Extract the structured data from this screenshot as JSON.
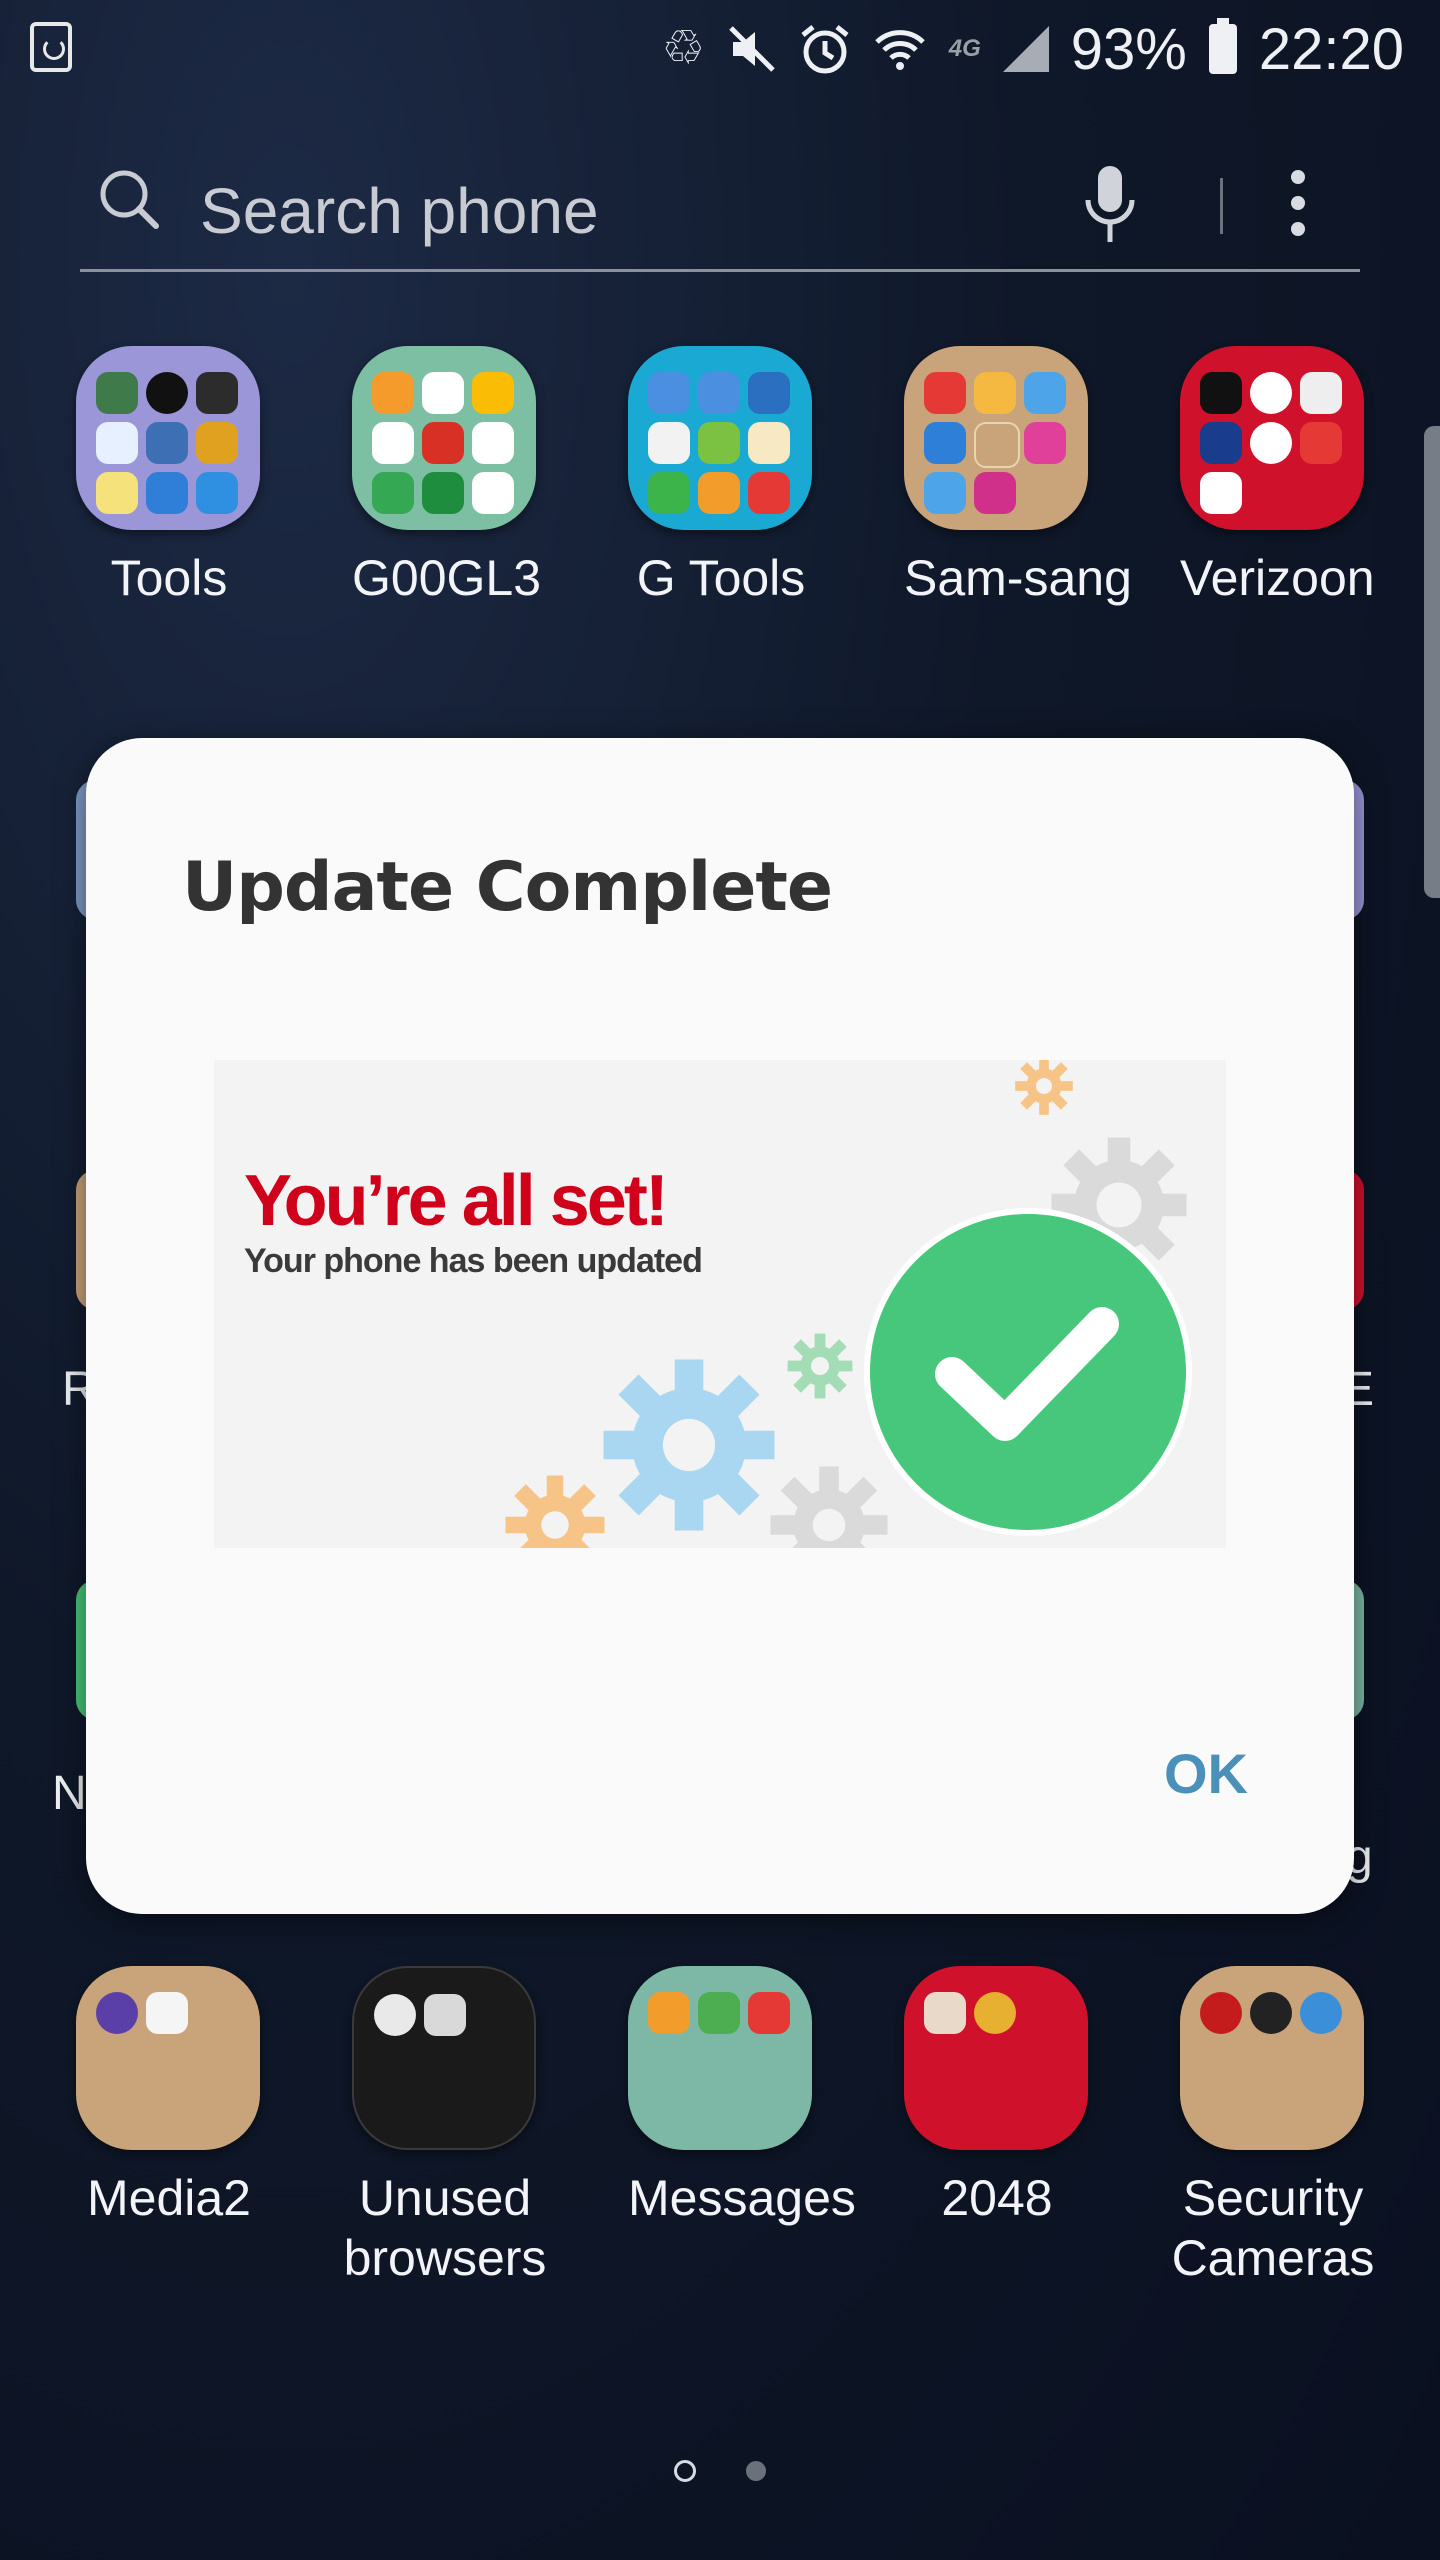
{
  "status_bar": {
    "battery": "93%",
    "time": "22:20",
    "network": "4G",
    "icons": [
      "recycle-icon",
      "mute-icon",
      "alarm-icon",
      "wifi-icon",
      "lte-icon",
      "signal-icon",
      "battery-icon"
    ]
  },
  "search": {
    "placeholder": "Search phone"
  },
  "folders_top": [
    {
      "label": "Tools",
      "color": "#9b96d8"
    },
    {
      "label": "G00GL3",
      "color": "#7dbfa3"
    },
    {
      "label": "G Tools",
      "color": "#1aa9d2"
    },
    {
      "label": "Sam-sang",
      "color": "#c9a37a"
    },
    {
      "label": "Verizoon",
      "color": "#d0112b"
    }
  ],
  "folders_bottom": [
    {
      "label": "Media2",
      "color": "#c9a37a"
    },
    {
      "label": "Unused browsers",
      "color": "#1a1a1a"
    },
    {
      "label": "Messages",
      "color": "#7cb8a5"
    },
    {
      "label": "2048",
      "color": "#d0112b"
    },
    {
      "label": "Security Cameras",
      "color": "#c9a37a"
    }
  ],
  "peek_labels": {
    "left_row2": "R",
    "right_row2": "PE",
    "left_row3": "N",
    "right_row3": "g"
  },
  "dialog": {
    "title": "Update Complete",
    "banner_headline": "You’re all set!",
    "banner_subtext": "Your phone has been updated",
    "ok_label": "OK"
  },
  "colors": {
    "accent": "#4a90b8",
    "brand_red": "#d0021b",
    "success_green": "#47c77b"
  }
}
